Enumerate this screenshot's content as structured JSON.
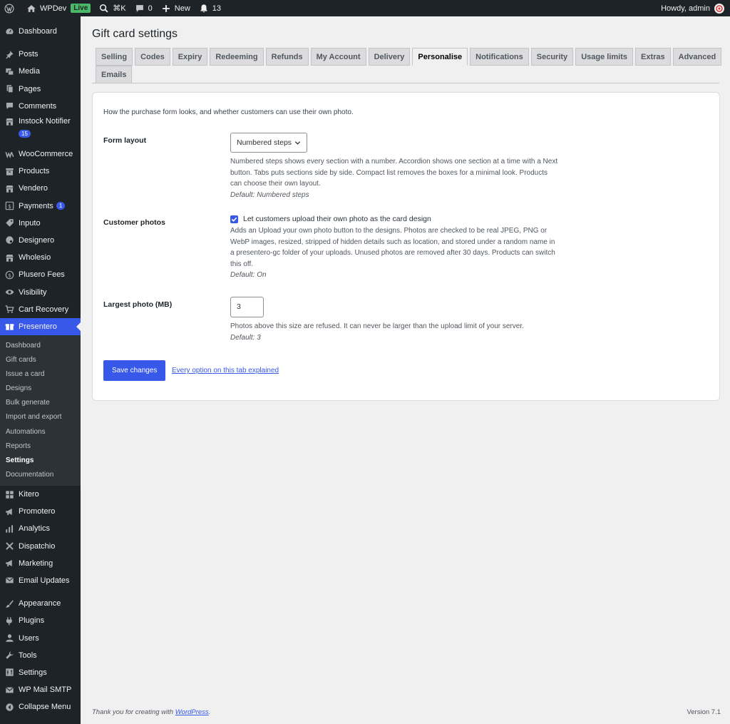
{
  "adminbar": {
    "site_name": "WPDev",
    "live_label": "Live",
    "search_shortcut": "⌘K",
    "comments_count": "0",
    "new_label": "New",
    "notifications_count": "13",
    "greeting": "Howdy, admin"
  },
  "sidebar": {
    "group1": [
      {
        "label": "Dashboard",
        "icon": "dashboard-icon"
      }
    ],
    "group2": [
      {
        "label": "Posts",
        "icon": "pin-icon"
      },
      {
        "label": "Media",
        "icon": "media-icon"
      },
      {
        "label": "Pages",
        "icon": "pages-icon"
      },
      {
        "label": "Comments",
        "icon": "comment-icon"
      },
      {
        "label": "Instock Notifier",
        "icon": "store-icon",
        "badge": "15"
      }
    ],
    "group3": [
      {
        "label": "WooCommerce",
        "icon": "woo-icon"
      },
      {
        "label": "Products",
        "icon": "archive-icon"
      },
      {
        "label": "Vendero",
        "icon": "store-icon"
      },
      {
        "label": "Payments",
        "icon": "dollar-icon",
        "badge": "1"
      },
      {
        "label": "Inputo",
        "icon": "tag-icon"
      },
      {
        "label": "Designero",
        "icon": "palette-icon"
      },
      {
        "label": "Wholesio",
        "icon": "store-icon"
      },
      {
        "label": "Plusero Fees",
        "icon": "money-icon"
      },
      {
        "label": "Visibility",
        "icon": "eye-icon"
      },
      {
        "label": "Cart Recovery",
        "icon": "cart-icon"
      },
      {
        "label": "Presentero",
        "icon": "gift-icon"
      }
    ],
    "submenu": [
      "Dashboard",
      "Gift cards",
      "Issue a card",
      "Designs",
      "Bulk generate",
      "Import and export",
      "Automations",
      "Reports",
      "Settings",
      "Documentation"
    ],
    "current_submenu": "Settings",
    "group4": [
      {
        "label": "Kitero",
        "icon": "grid-icon"
      },
      {
        "label": "Promotero",
        "icon": "megaphone-icon"
      },
      {
        "label": "Analytics",
        "icon": "chart-icon"
      },
      {
        "label": "Dispatchio",
        "icon": "tools-icon"
      },
      {
        "label": "Marketing",
        "icon": "megaphone-icon"
      },
      {
        "label": "Email Updates",
        "icon": "mail-icon"
      }
    ],
    "group5": [
      {
        "label": "Appearance",
        "icon": "brush-icon"
      },
      {
        "label": "Plugins",
        "icon": "plugin-icon"
      },
      {
        "label": "Users",
        "icon": "user-icon"
      },
      {
        "label": "Tools",
        "icon": "wrench-icon"
      },
      {
        "label": "Settings",
        "icon": "settings-icon"
      },
      {
        "label": "WP Mail SMTP",
        "icon": "mail-icon"
      },
      {
        "label": "Collapse Menu",
        "icon": "collapse-icon"
      }
    ]
  },
  "page": {
    "title": "Gift card settings",
    "tabs": [
      "Selling",
      "Codes",
      "Expiry",
      "Redeeming",
      "Refunds",
      "My Account",
      "Delivery",
      "Personalise",
      "Notifications",
      "Security",
      "Usage limits",
      "Extras",
      "Advanced",
      "Emails"
    ],
    "active_tab": "Personalise",
    "intro": "How the purchase form looks, and whether customers can use their own photo.",
    "form_layout": {
      "label": "Form layout",
      "value": "Numbered steps",
      "desc": "Numbered steps shows every section with a number. Accordion shows one section at a time with a Next button. Tabs puts sections side by side. Compact list removes the boxes for a minimal look. Products can choose their own layout.",
      "default": "Default: Numbered steps"
    },
    "customer_photos": {
      "label": "Customer photos",
      "checkbox_label": "Let customers upload their own photo as the card design",
      "checked": true,
      "desc": "Adds an Upload your own photo button to the designs. Photos are checked to be real JPEG, PNG or WebP images, resized, stripped of hidden details such as location, and stored under a random name in a presentero-gc folder of your uploads. Unused photos are removed after 30 days. Products can switch this off.",
      "default": "Default: On"
    },
    "largest_photo": {
      "label": "Largest photo (MB)",
      "value": "3",
      "desc": "Photos above this size are refused. It can never be larger than the upload limit of your server.",
      "default": "Default: 3"
    },
    "save_label": "Save changes",
    "explain_link": "Every option on this tab explained"
  },
  "footer": {
    "thanks_prefix": "Thank you for creating with ",
    "wp_link": "WordPress",
    "thanks_suffix": ".",
    "version": "Version 7.1"
  }
}
